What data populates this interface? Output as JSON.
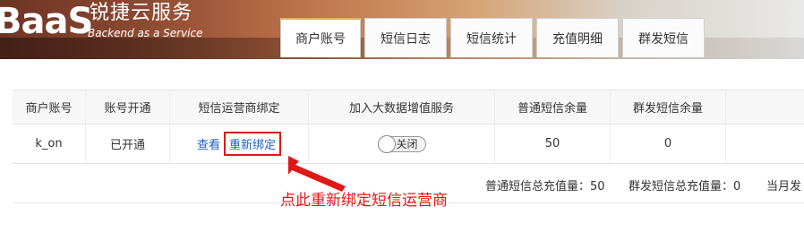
{
  "brand": {
    "logo_text": "BaaS",
    "cn_name": "锐捷云服务",
    "tagline": "Backend as a Service"
  },
  "tabs": [
    {
      "label": "商户账号",
      "active": true
    },
    {
      "label": "短信日志",
      "active": false
    },
    {
      "label": "短信统计",
      "active": false
    },
    {
      "label": "充值明细",
      "active": false
    },
    {
      "label": "群发短信",
      "active": false
    }
  ],
  "table": {
    "headers": [
      "商户账号",
      "账号开通",
      "短信运营商绑定",
      "加入大数据增值服务",
      "普通短信余量",
      "群发短信余量",
      ""
    ],
    "row": {
      "account": "k_on",
      "status": "已开通",
      "view_link": "查看",
      "rebind_link": "重新绑定",
      "bigdata_toggle": {
        "state": "off",
        "label": "关闭"
      },
      "normal_sms_balance": "50",
      "group_sms_balance": "0"
    }
  },
  "summary": {
    "normal_total": "普通短信总充值量：50",
    "group_total": "群发短信总充值量：0",
    "month_total": "当月发"
  },
  "annotation": {
    "note": "点此重新绑定短信运营商",
    "color": "#e01818"
  }
}
